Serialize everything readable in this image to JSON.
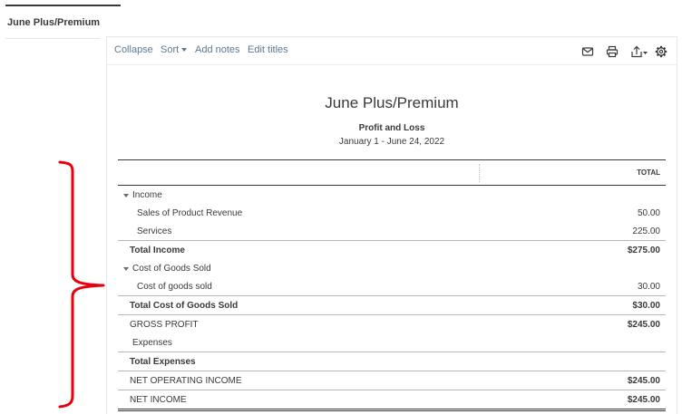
{
  "sidebar": {
    "tab_label": "June Plus/Premium"
  },
  "toolbar": {
    "collapse_label": "Collapse",
    "sort_label": "Sort",
    "add_notes_label": "Add notes",
    "edit_titles_label": "Edit titles",
    "icons": [
      "mail-icon",
      "print-icon",
      "export-icon",
      "gear-icon"
    ]
  },
  "report": {
    "company": "June Plus/Premium",
    "title": "Profit and Loss",
    "date_range": "January 1 - June 24, 2022",
    "column_header": "TOTAL",
    "rows": [
      {
        "label": "Income",
        "value": "",
        "indent": 1,
        "style": "section",
        "collapsible": true
      },
      {
        "label": "Sales of Product Revenue",
        "value": "50.00",
        "indent": 2,
        "style": "item"
      },
      {
        "label": "Services",
        "value": "225.00",
        "indent": 2,
        "style": "item"
      },
      {
        "label": "Total Income",
        "value": "$275.00",
        "indent": 0,
        "style": "total"
      },
      {
        "label": "Cost of Goods Sold",
        "value": "",
        "indent": 1,
        "style": "section",
        "collapsible": true
      },
      {
        "label": "Cost of goods sold",
        "value": "30.00",
        "indent": 2,
        "style": "item"
      },
      {
        "label": "Total Cost of Goods Sold",
        "value": "$30.00",
        "indent": 0,
        "style": "total"
      },
      {
        "label": "GROSS PROFIT",
        "value": "$245.00",
        "indent": 0,
        "style": "summary"
      },
      {
        "label": "Expenses",
        "value": "",
        "indent": 1,
        "style": "section",
        "collapsible": false
      },
      {
        "label": "Total Expenses",
        "value": "",
        "indent": 0,
        "style": "total"
      },
      {
        "label": "NET OPERATING INCOME",
        "value": "$245.00",
        "indent": 0,
        "style": "summary"
      },
      {
        "label": "NET INCOME",
        "value": "$245.00",
        "indent": 0,
        "style": "final"
      }
    ]
  },
  "colors": {
    "link": "#5b7a96",
    "text": "#393a3d",
    "annotation": "#e8000b"
  }
}
